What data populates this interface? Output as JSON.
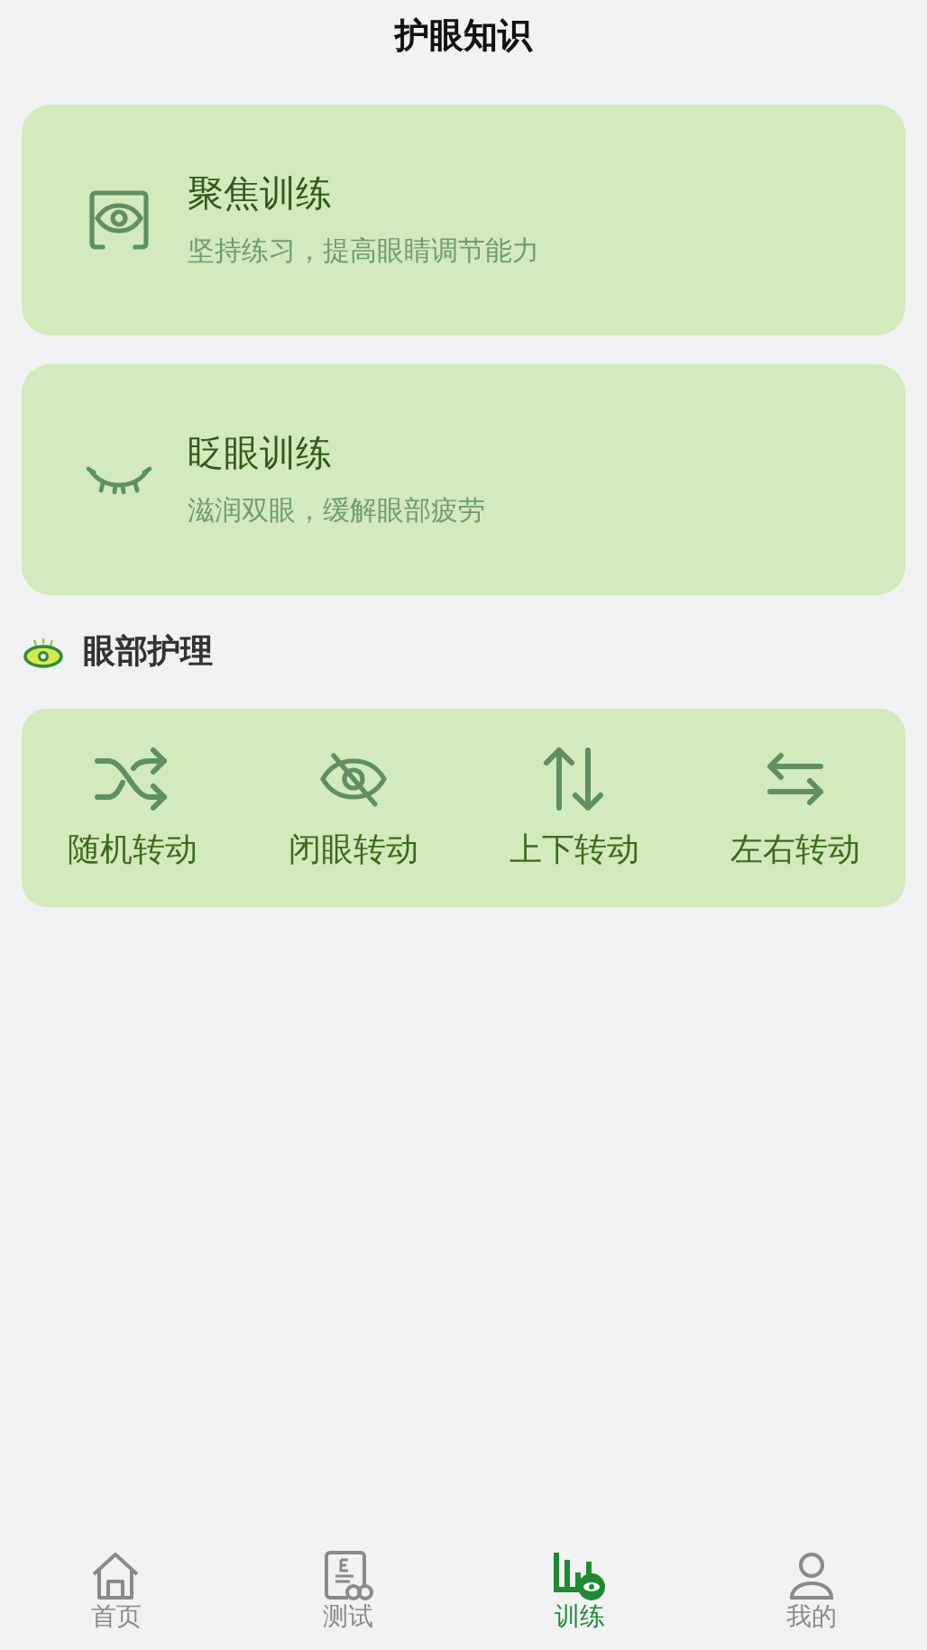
{
  "header": {
    "title": "护眼知识"
  },
  "trainings": [
    {
      "title": "聚焦训练",
      "subtitle": "坚持练习，提高眼睛调节能力"
    },
    {
      "title": "眨眼训练",
      "subtitle": "滋润双眼，缓解眼部疲劳"
    }
  ],
  "care_section": {
    "title": "眼部护理",
    "items": [
      {
        "label": "随机转动"
      },
      {
        "label": "闭眼转动"
      },
      {
        "label": "上下转动"
      },
      {
        "label": "左右转动"
      }
    ]
  },
  "tab_bar": [
    {
      "label": "首页",
      "selected": false
    },
    {
      "label": "测试",
      "selected": false
    },
    {
      "label": "训练",
      "selected": true
    },
    {
      "label": "我的",
      "selected": false
    }
  ]
}
